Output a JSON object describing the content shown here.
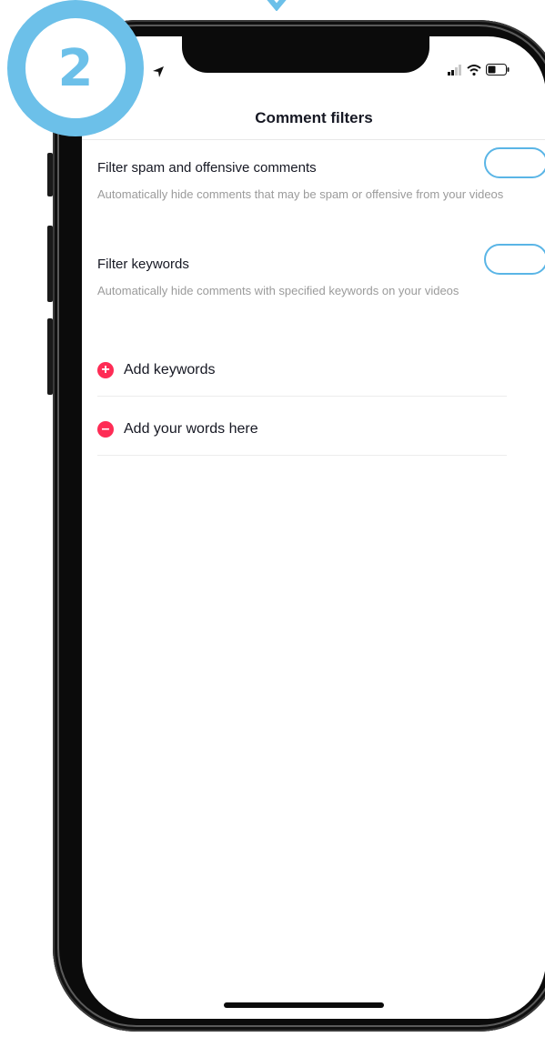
{
  "step_badge": "2",
  "nav": {
    "title": "Comment filters"
  },
  "settings": [
    {
      "title": "Filter spam and offensive comments",
      "description": "Automatically hide comments that may be spam or offensive from your videos"
    },
    {
      "title": "Filter keywords",
      "description": "Automatically hide comments with specified keywords on your videos"
    }
  ],
  "actions": {
    "add_keywords": "Add keywords",
    "add_words": "Add your words here"
  },
  "icons": {
    "location": "location-arrow-icon",
    "signal": "cellular-signal-icon",
    "wifi": "wifi-icon",
    "battery": "battery-icon",
    "add": "plus-circle-icon",
    "remove": "minus-circle-icon"
  },
  "colors": {
    "accent_red": "#fe2c55",
    "highlight_blue": "#6cc0e9",
    "text_primary": "#161823",
    "text_secondary": "#9b9b9b"
  }
}
